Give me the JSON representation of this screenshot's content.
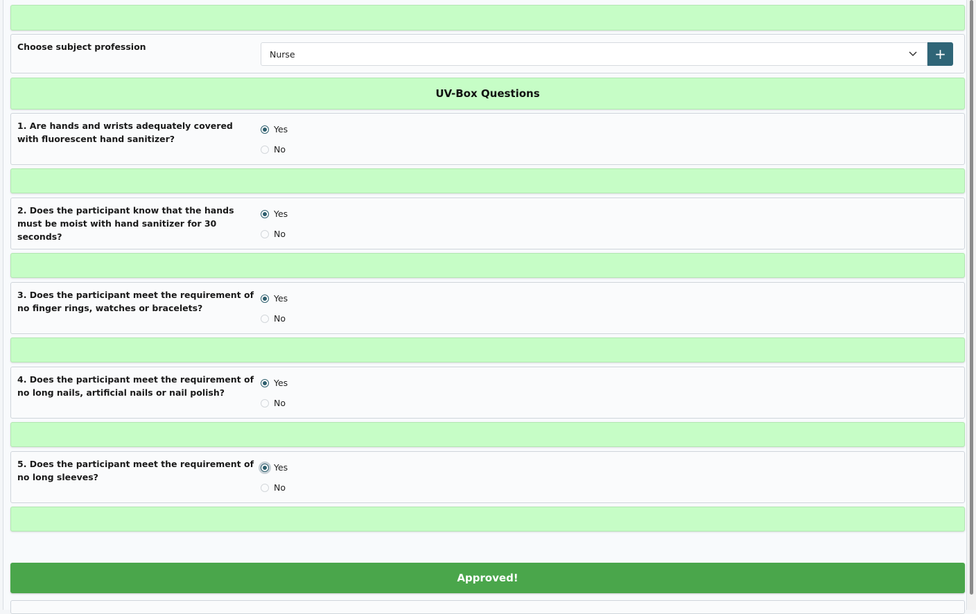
{
  "profession": {
    "label": "Choose subject profession",
    "selected": "Nurse",
    "add_icon": "plus-icon",
    "dropdown_icon": "chevron-down-icon"
  },
  "section": {
    "title": "UV-Box Questions"
  },
  "questions": [
    {
      "text": "1. Are hands and wrists adequately covered with fluorescent hand sanitizer?",
      "yes": "Yes",
      "no": "No",
      "selected": "Yes"
    },
    {
      "text": "2. Does the participant know that the hands must be moist with hand sanitizer for 30 seconds?",
      "yes": "Yes",
      "no": "No",
      "selected": "Yes"
    },
    {
      "text": "3. Does the participant meet the requirement of no finger rings, watches or bracelets?",
      "yes": "Yes",
      "no": "No",
      "selected": "Yes"
    },
    {
      "text": "4. Does the participant meet the requirement of no long nails, artificial nails or nail polish?",
      "yes": "Yes",
      "no": "No",
      "selected": "Yes"
    },
    {
      "text": "5. Does the participant meet the requirement of no long sleeves?",
      "yes": "Yes",
      "no": "No",
      "selected": "Yes"
    }
  ],
  "approve": {
    "label": "Approved!"
  },
  "colors": {
    "section_green": "#c6fdc6",
    "approve_green": "#4aa64b",
    "accent": "#2f6577"
  }
}
